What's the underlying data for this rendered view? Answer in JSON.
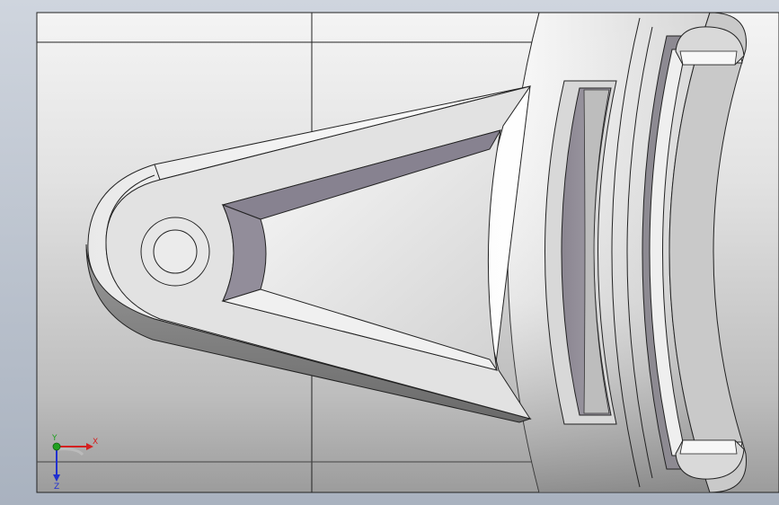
{
  "viewport": {
    "background_top": "#cfd5de",
    "background_bottom": "#a9b2bf",
    "model_color": "#dcdcdc"
  },
  "triad": {
    "x_label": "X",
    "y_label": "Y",
    "z_label": "Z",
    "x_color": "#d42020",
    "y_color": "#20a020",
    "z_color": "#2030d0"
  }
}
